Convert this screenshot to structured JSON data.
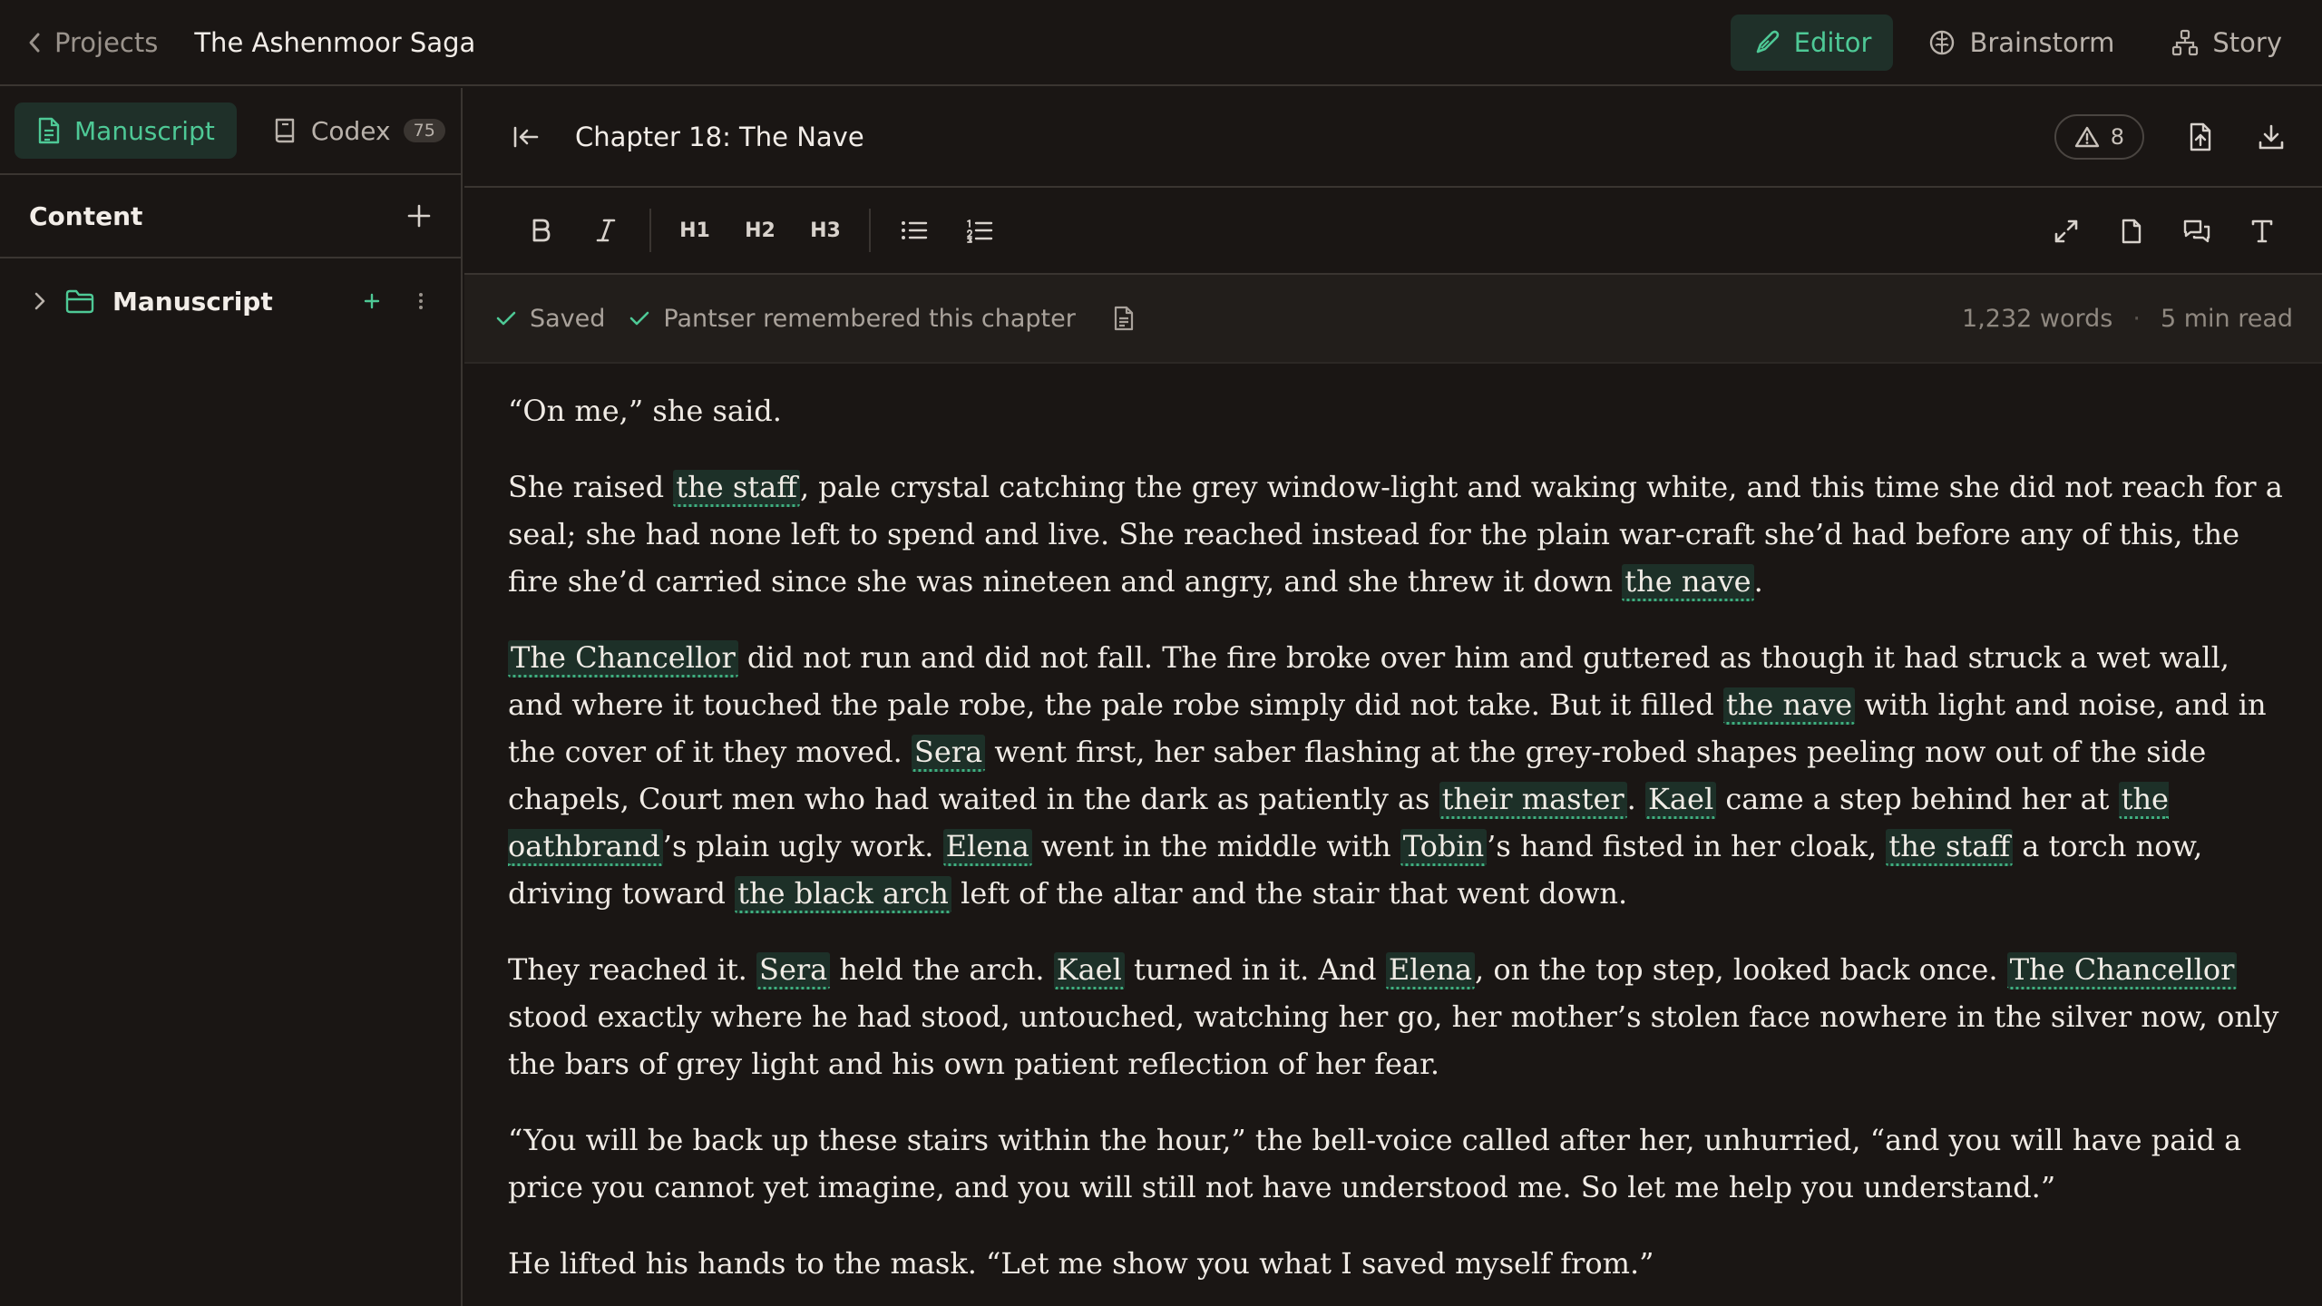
{
  "header": {
    "back_label": "Projects",
    "project_title": "The Ashenmoor Saga",
    "tabs": [
      {
        "label": "Editor",
        "icon": "pen-icon",
        "active": true
      },
      {
        "label": "Brainstorm",
        "icon": "brain-icon",
        "active": false
      },
      {
        "label": "Story",
        "icon": "network-icon",
        "active": false
      }
    ]
  },
  "sidebar": {
    "tabs": [
      {
        "label": "Manuscript",
        "icon": "document-icon",
        "active": true
      },
      {
        "label": "Codex",
        "icon": "book-icon",
        "badge": "75",
        "active": false
      }
    ],
    "content_title": "Content",
    "tree": [
      {
        "label": "Manuscript",
        "icon": "folder-icon",
        "expanded": false
      }
    ]
  },
  "chapter": {
    "title": "Chapter 18: The Nave",
    "warning_count": "8"
  },
  "toolbar": {
    "h1": "H1",
    "h2": "H2",
    "h3": "H3"
  },
  "status": {
    "saved": "Saved",
    "remembered": "Pantser remembered this chapter",
    "words": "1,232 words",
    "dot": "·",
    "read_time": "5 min read"
  },
  "colors": {
    "accent": "#4ec996",
    "background": "#1a1614",
    "entity_highlight": "#1d3028"
  },
  "manuscript": {
    "p1": "“On me,” she said.",
    "p2": [
      "She raised ",
      {
        "e": "the staff"
      },
      ", pale crystal catching the grey window-light and waking white, and this time she did not reach for a seal; she had none left to spend and live. She reached instead for the plain war-craft she’d had before any of this, the fire she’d carried since she was nineteen and angry, and she threw it down ",
      {
        "e": "the nave"
      },
      "."
    ],
    "p3": [
      {
        "e": "The Chancellor"
      },
      " did not run and did not fall. The fire broke over him and guttered as though it had struck a wet wall, and where it touched the pale robe, the pale robe simply did not take. But it filled ",
      {
        "e": "the nave"
      },
      " with light and noise, and in the cover of it they moved. ",
      {
        "e": "Sera"
      },
      " went first, her saber flashing at the grey-robed shapes peeling now out of the side chapels, Court men who had waited in the dark as patiently as ",
      {
        "e": "their master"
      },
      ". ",
      {
        "e": "Kael"
      },
      " came a step behind her at ",
      {
        "e": "the oathbrand"
      },
      "’s plain ugly work. ",
      {
        "e": "Elena"
      },
      " went in the middle with ",
      {
        "e": "Tobin"
      },
      "’s hand fisted in her cloak, ",
      {
        "e": "the staff"
      },
      " a torch now, driving toward ",
      {
        "e": "the black arch"
      },
      " left of the altar and the stair that went down."
    ],
    "p4": [
      "They reached it. ",
      {
        "e": "Sera"
      },
      " held the arch. ",
      {
        "e": "Kael"
      },
      " turned in it. And ",
      {
        "e": "Elena"
      },
      ", on the top step, looked back once. ",
      {
        "e": "The Chancellor"
      },
      " stood exactly where he had stood, untouched, watching her go, her mother’s stolen face nowhere in the silver now, only the bars of grey light and his own patient reflection of her fear."
    ],
    "p5": "“You will be back up these stairs within the hour,” the bell-voice called after her, unhurried, “and you will have paid a price you cannot yet imagine, and you will still not have understood me. So let me help you understand.”",
    "p6": "He lifted his hands to the mask. “Let me show you what I saved myself from.”"
  }
}
